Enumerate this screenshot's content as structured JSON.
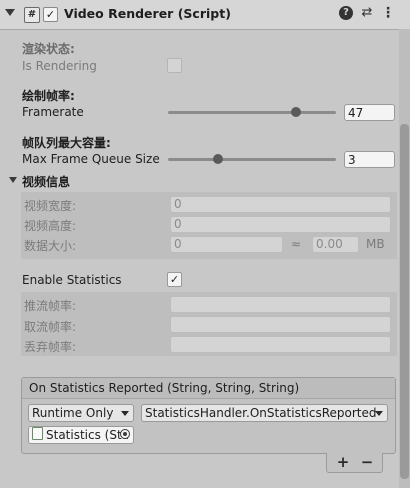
{
  "header": {
    "script_icon": "#",
    "enabled_mark": "✓",
    "title": "Video Renderer (Script)"
  },
  "icons": {
    "help": "?",
    "presets": "⇄",
    "more": "⋮",
    "checkmark": "✓"
  },
  "render_state": {
    "heading": "渲染状态:",
    "label": "Is Rendering",
    "checked": false
  },
  "framerate": {
    "heading": "绘制帧率:",
    "label": "Framerate",
    "value": "47",
    "slider_fraction": 0.76
  },
  "queue": {
    "heading": "帧队列最大容量:",
    "label": "Max Frame Queue Size",
    "value": "3",
    "slider_fraction": 0.3
  },
  "video_info": {
    "heading": "视频信息",
    "width_label": "视频宽度:",
    "width_value": "0",
    "height_label": "视频高度:",
    "height_value": "0",
    "size_label": "数据大小:",
    "size_value": "0",
    "approx": "≈",
    "size_mb_value": "0.00",
    "size_unit": "MB"
  },
  "statistics": {
    "label": "Enable Statistics",
    "checked": true,
    "push_label": "推流帧率:",
    "fetch_label": "取流帧率:",
    "drop_label": "丢弃帧率:"
  },
  "event": {
    "title": "On Statistics Reported (String, String, String)",
    "mode": "Runtime Only",
    "function": "StatisticsHandler.OnStatisticsReported",
    "target": "Statistics (Sta",
    "add": "+",
    "remove": "−"
  }
}
